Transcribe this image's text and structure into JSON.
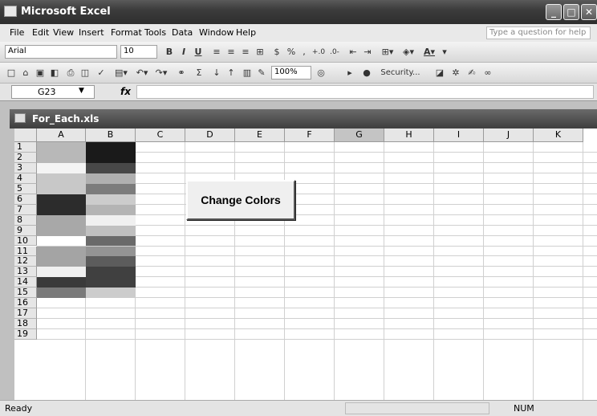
{
  "app": {
    "title": "Microsoft Excel"
  },
  "menu": {
    "items": [
      "File",
      "Edit",
      "View",
      "Insert",
      "Format",
      "Tools",
      "Data",
      "Window",
      "Help"
    ],
    "help_placeholder": "Type a question for help"
  },
  "format_toolbar": {
    "font": "Arial",
    "size": "10",
    "bold": "B",
    "italic": "I",
    "underline": "U",
    "currency": "$",
    "percent": "%",
    "comma": ","
  },
  "standard_toolbar": {
    "zoom": "100%",
    "security": "Security...",
    "sum": "Σ"
  },
  "formula_bar": {
    "name_box": "G23",
    "fx": "fx",
    "value": ""
  },
  "workbook": {
    "title": "For_Each.xls"
  },
  "grid": {
    "columns": [
      "A",
      "B",
      "C",
      "D",
      "E",
      "F",
      "G",
      "H",
      "I",
      "J",
      "K"
    ],
    "rows": [
      "1",
      "2",
      "3",
      "4",
      "5",
      "6",
      "7",
      "8",
      "9",
      "10",
      "11",
      "12",
      "13",
      "14",
      "15",
      "16",
      "17",
      "18",
      "19"
    ],
    "selected_column": "G",
    "colA_colors": [
      "#b8b8b8",
      "#b8b8b8",
      "#f4f4f4",
      "#c8c8c8",
      "#c8c8c8",
      "#2c2c2c",
      "#2c2c2c",
      "#a8a8a8",
      "#a8a8a8",
      "#ffffff",
      "#a4a4a4",
      "#a4a4a4",
      "#f0f0f0",
      "#3a3a3a",
      "#7a7a7a"
    ],
    "colB_colors": [
      "#1a1a1a",
      "#1a1a1a",
      "#484848",
      "#b0b0b0",
      "#7c7c7c",
      "#cccccc",
      "#b4b4b4",
      "#f0f0f0",
      "#c0c0c0",
      "#6a6a6a",
      "#949494",
      "#5c5c5c",
      "#404040",
      "#404040",
      "#cccccc"
    ]
  },
  "button": {
    "label": "Change Colors"
  },
  "status": {
    "ready": "Ready",
    "num": "NUM"
  }
}
